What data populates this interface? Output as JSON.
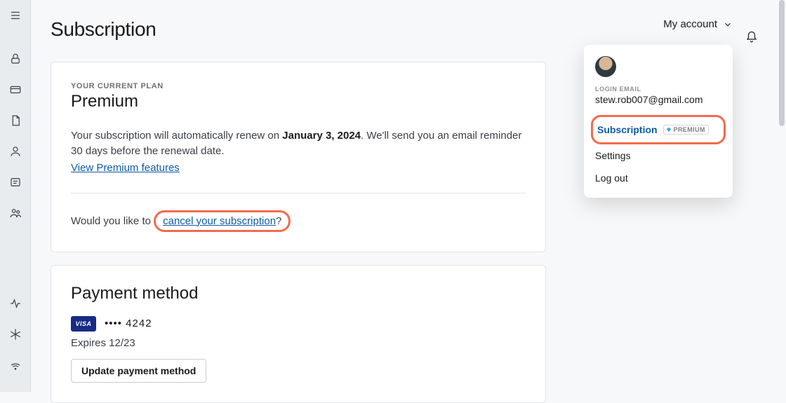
{
  "page": {
    "title": "Subscription"
  },
  "header": {
    "account_label": "My account"
  },
  "plan_card": {
    "eyebrow": "YOUR CURRENT PLAN",
    "name": "Premium",
    "renew_prefix": "Your subscription will automatically renew on ",
    "renew_date": "January 3, 2024",
    "renew_suffix": ". We'll send you an email reminder 30 days before the renewal date.",
    "view_features": "View Premium features",
    "cancel_prefix": "Would you like to ",
    "cancel_link": "cancel your subscription",
    "cancel_suffix": "?"
  },
  "payment_card": {
    "title": "Payment method",
    "brand": "VISA",
    "masked": "•••• 4242",
    "expires": "Expires 12/23",
    "update_btn": "Update payment method"
  },
  "dropdown": {
    "login_label": "LOGIN EMAIL",
    "email": "stew.rob007@gmail.com",
    "subscription": "Subscription",
    "premium_badge": "PREMIUM",
    "settings": "Settings",
    "logout": "Log out"
  },
  "highlight_color": "#f26b4e"
}
